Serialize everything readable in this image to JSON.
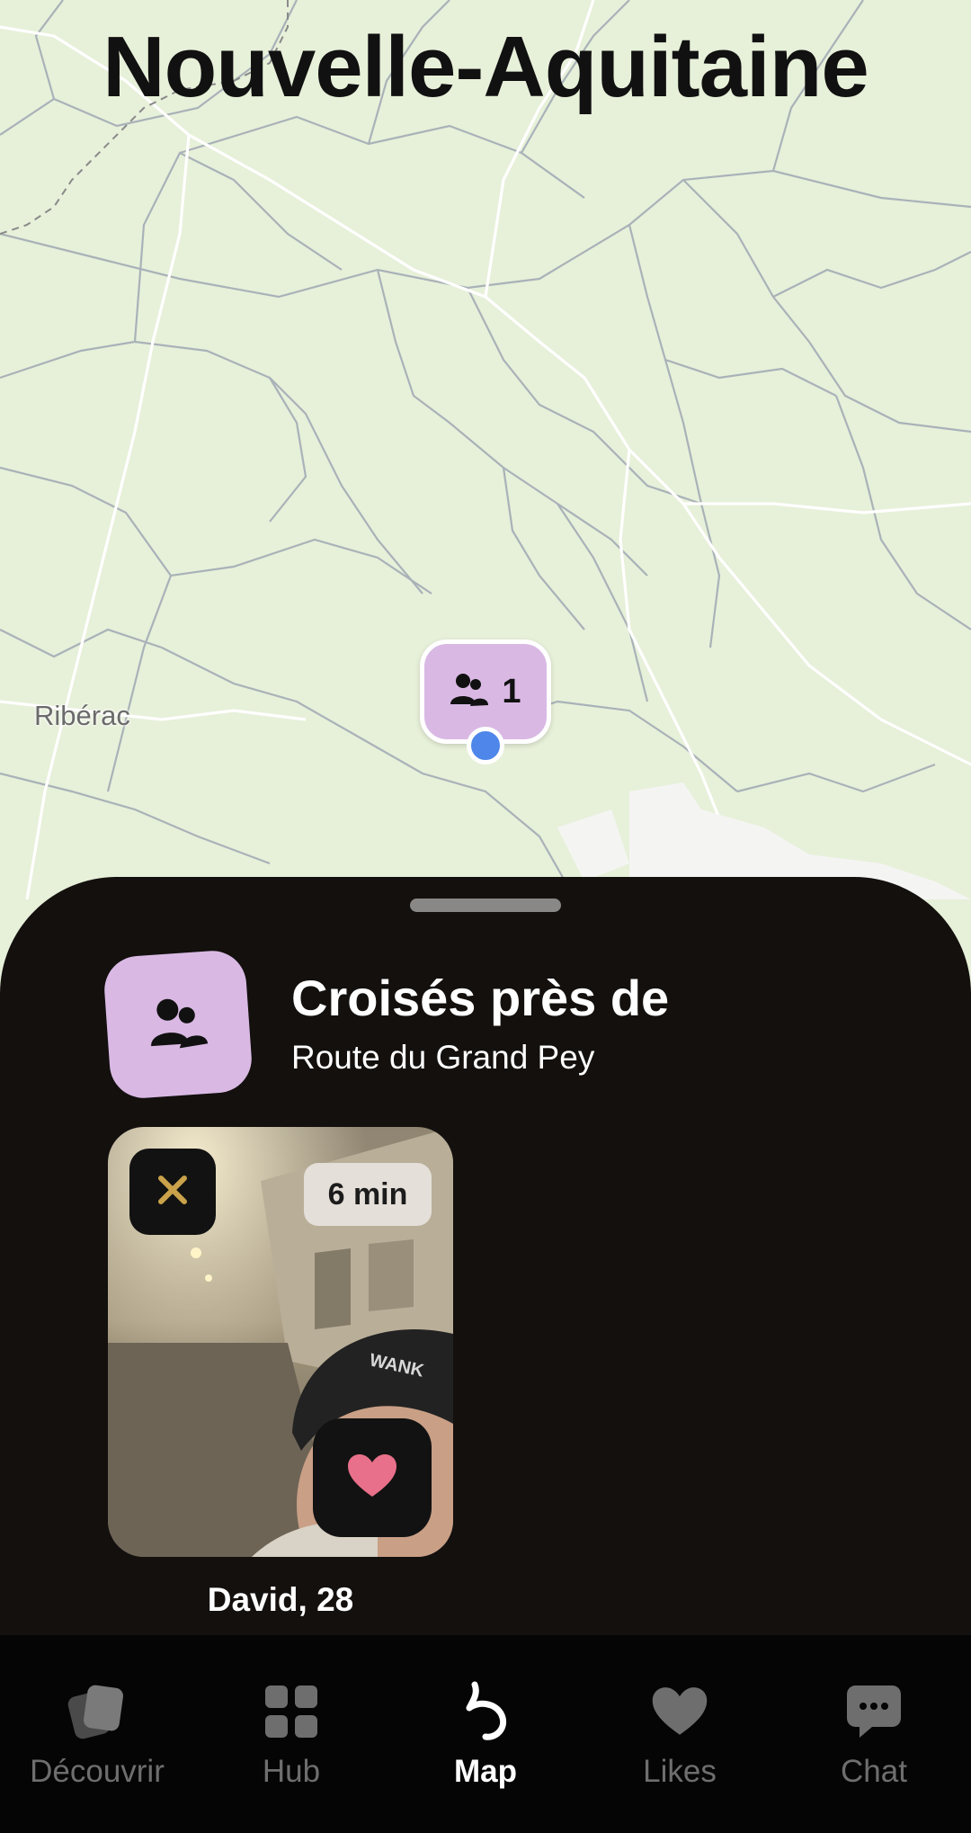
{
  "map": {
    "region_title": "Nouvelle-Aquitaine",
    "town_label": "Ribérac",
    "cluster": {
      "count": "1",
      "icon": "group-icon",
      "color": "#d9b9e4"
    },
    "user_location_color": "#4f86ea",
    "background_color": "#e7f0d9"
  },
  "sheet": {
    "title": "Croisés près de",
    "subtitle": "Route du Grand Pey",
    "badge_icon": "group-icon",
    "background_color": "#13100e"
  },
  "profile_card": {
    "time_ago": "6 min",
    "name": "David, 28",
    "dismiss_icon": "close-icon",
    "like_icon": "heart-icon",
    "accent_dismiss": "#c9a24a",
    "accent_like": "#e8708a"
  },
  "tabbar": {
    "items": [
      {
        "label": "Découvrir",
        "icon": "cards-icon",
        "active": false
      },
      {
        "label": "Hub",
        "icon": "grid-icon",
        "active": false
      },
      {
        "label": "Map",
        "icon": "map-logo-icon",
        "active": true
      },
      {
        "label": "Likes",
        "icon": "heart-icon",
        "active": false
      },
      {
        "label": "Chat",
        "icon": "chat-bubble-icon",
        "active": false
      }
    ]
  }
}
